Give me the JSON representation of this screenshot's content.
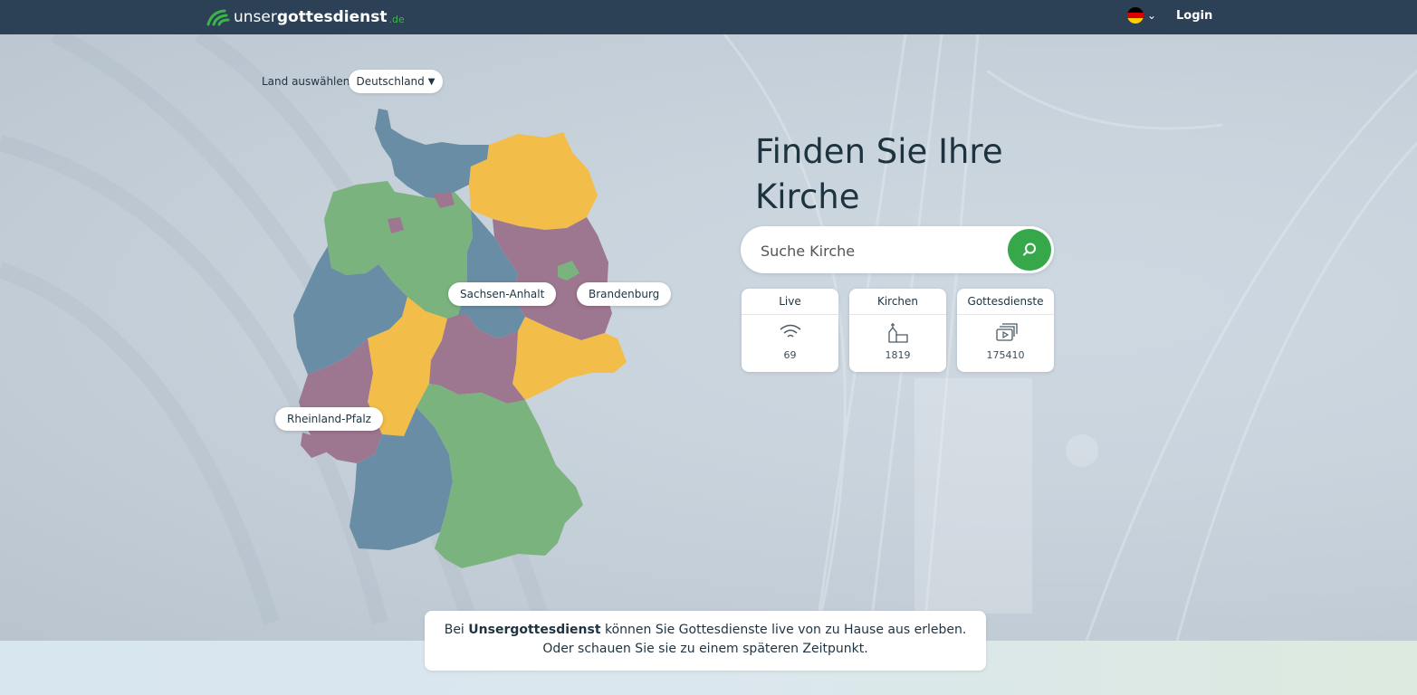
{
  "header": {
    "logo": {
      "part1": "unser",
      "part2": "gottesdienst",
      "tld": ".de"
    },
    "language": {
      "flag_colors": [
        "#000000",
        "#dd0000",
        "#ffce00"
      ]
    },
    "login_label": "Login"
  },
  "country_select": {
    "label": "Land auswählen",
    "value": "Deutschland"
  },
  "map": {
    "colors": {
      "blue": "#698da4",
      "green": "#7bb37e",
      "yellow": "#f2bd48",
      "purple": "#9d7690"
    },
    "labels": [
      "Sachsen-Anhalt",
      "Brandenburg",
      "Rheinland-Pfalz"
    ]
  },
  "hero": {
    "headline_line1": "Finden Sie Ihre",
    "headline_line2": "Kirche"
  },
  "search": {
    "placeholder": "Suche Kirche"
  },
  "stats": [
    {
      "label": "Live",
      "value": "69",
      "icon": "wifi-icon"
    },
    {
      "label": "Kirchen",
      "value": "1819",
      "icon": "church-icon"
    },
    {
      "label": "Gottesdienste",
      "value": "175410",
      "icon": "video-stack-icon"
    }
  ],
  "info": {
    "brand": "Unsergottesdienst",
    "line1_rest": " können Sie Gottesdienste live von zu Hause aus erleben.",
    "line1_prefix": "Bei ",
    "line2": "Oder schauen Sie sie zu einem späteren Zeitpunkt."
  },
  "colors": {
    "topbar": "#2c4056",
    "accent_green": "#36a84a"
  }
}
